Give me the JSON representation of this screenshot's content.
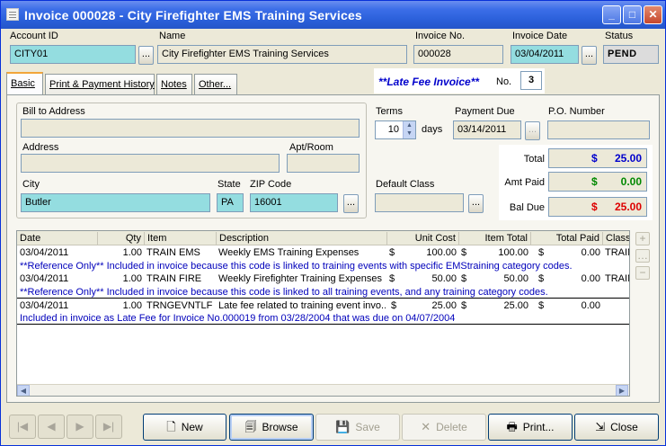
{
  "window": {
    "title": "Invoice  000028 - City Firefighter EMS Training Services"
  },
  "header": {
    "account_id_label": "Account ID",
    "account_id": "CITY01",
    "name_label": "Name",
    "name": "City Firefighter EMS Training Services",
    "invoice_no_label": "Invoice No.",
    "invoice_no": "000028",
    "invoice_date_label": "Invoice Date",
    "invoice_date": "03/04/2011",
    "status_label": "Status",
    "status": "PEND",
    "ellipsis": "..."
  },
  "tabs": [
    {
      "label": "Basic"
    },
    {
      "label": "Print & Payment History"
    },
    {
      "label": "Notes"
    },
    {
      "label": "Other..."
    }
  ],
  "late_fee": {
    "title": "**Late Fee Invoice**",
    "no_label": "No.",
    "no_value": "3"
  },
  "address": {
    "bill_to_label": "Bill to Address",
    "bill_to": "",
    "address_label": "Address",
    "address": "",
    "apt_label": "Apt/Room",
    "apt": "",
    "city_label": "City",
    "city": "Butler",
    "state_label": "State",
    "state": "PA",
    "zip_label": "ZIP Code",
    "zip": "16001"
  },
  "terms": {
    "terms_label": "Terms",
    "terms_value": "10",
    "days_label": "days",
    "payment_due_label": "Payment Due",
    "payment_due": "03/14/2011",
    "po_label": "P.O. Number",
    "po": "",
    "default_class_label": "Default Class",
    "default_class": ""
  },
  "totals": {
    "total_label": "Total",
    "total_currency": "$",
    "total": "25.00",
    "amt_paid_label": "Amt Paid",
    "amt_paid_currency": "$",
    "amt_paid": "0.00",
    "bal_due_label": "Bal Due",
    "bal_due_currency": "$",
    "bal_due": "25.00",
    "colors": {
      "total": "#0000cc",
      "amt_paid": "#008800",
      "bal_due": "#dd0000"
    }
  },
  "grid": {
    "columns": [
      "Date",
      "Qty",
      "Item",
      "Description",
      "Unit Cost",
      "Item Total",
      "Total Paid",
      "Class"
    ],
    "rows": [
      {
        "date": "03/04/2011",
        "qty": "1.00",
        "item": "TRAIN EMS",
        "desc": "Weekly EMS Training Expenses",
        "uc_cur": "$",
        "unit_cost": "100.00",
        "it_cur": "$",
        "item_total": "100.00",
        "tp_cur": "$",
        "total_paid": "0.00",
        "class": "TRAIN",
        "note": "**Reference Only** Included in invoice because this code is linked to training events with specific EMStraining category codes."
      },
      {
        "date": "03/04/2011",
        "qty": "1.00",
        "item": "TRAIN FIRE",
        "desc": "Weekly Firefighter Training Expenses",
        "uc_cur": "$",
        "unit_cost": "50.00",
        "it_cur": "$",
        "item_total": "50.00",
        "tp_cur": "$",
        "total_paid": "0.00",
        "class": "TRAIN",
        "note": "**Reference Only** Included in invoice because this code is linked to all training events, and any training category codes."
      },
      {
        "date": "03/04/2011",
        "qty": "1.00",
        "item": "TRNGEVNTLF",
        "desc": "Late fee related to training event invo...",
        "uc_cur": "$",
        "unit_cost": "25.00",
        "it_cur": "$",
        "item_total": "25.00",
        "tp_cur": "$",
        "total_paid": "0.00",
        "class": "",
        "note": "Included in invoice as Late Fee for Invoice No.000019 from 03/28/2004 that was due on 04/07/2004"
      }
    ]
  },
  "toolbar": {
    "new_label": "New",
    "browse_label": "Browse",
    "save_label": "Save",
    "delete_label": "Delete",
    "print_label": "Print...",
    "close_label": "Close"
  }
}
